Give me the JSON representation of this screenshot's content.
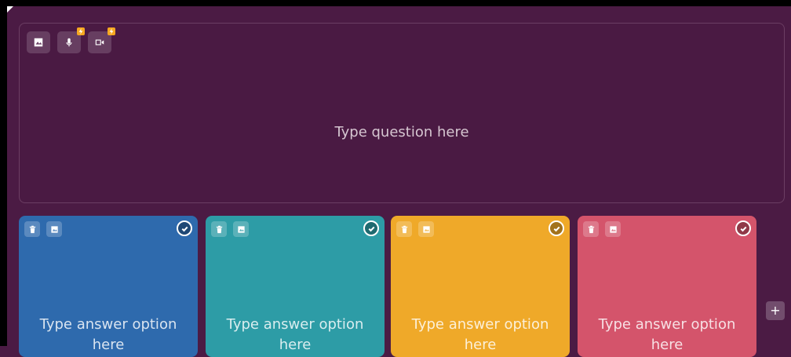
{
  "question": {
    "placeholder": "Type question here",
    "tools": [
      {
        "icon": "image-icon"
      },
      {
        "icon": "microphone-icon",
        "badge": "lightning-icon"
      },
      {
        "icon": "video-icon",
        "badge": "lightning-icon"
      }
    ]
  },
  "answers": [
    {
      "color": "#2e6aad",
      "placeholder": "Type answer option here"
    },
    {
      "color": "#2d9ca6",
      "placeholder": "Type answer option here"
    },
    {
      "color": "#efa929",
      "placeholder": "Type answer option here"
    },
    {
      "color": "#d4546b",
      "placeholder": "Type answer option here"
    }
  ],
  "add_option": {
    "label": "+"
  },
  "colors": {
    "background": "#4b1b44",
    "badge": "#f6a821"
  }
}
